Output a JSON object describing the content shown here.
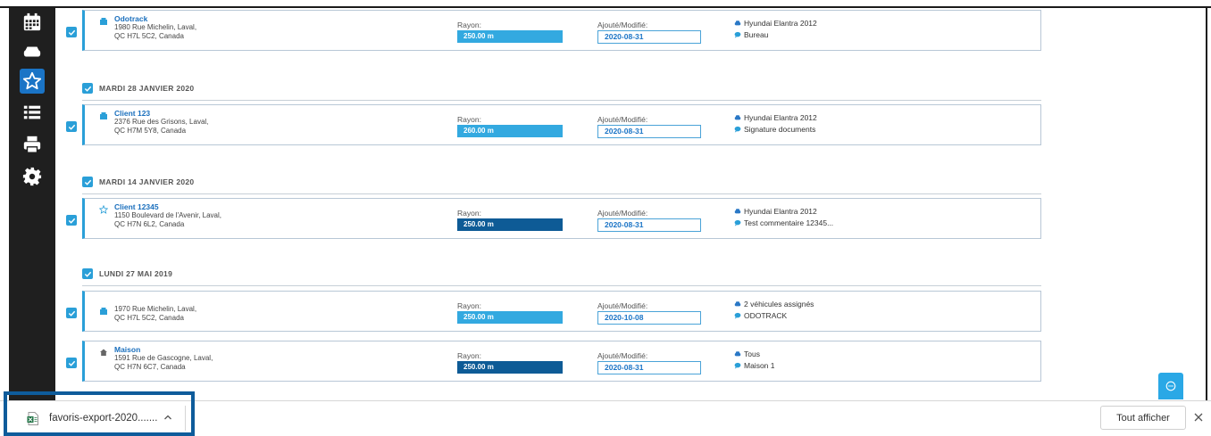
{
  "sidebar": {
    "items": [
      {
        "name": "calendar",
        "icon": "calendar-icon",
        "active": false
      },
      {
        "name": "vehicle",
        "icon": "car-icon",
        "active": false
      },
      {
        "name": "favorites",
        "icon": "star-icon",
        "active": true
      },
      {
        "name": "list",
        "icon": "list-icon",
        "active": false
      },
      {
        "name": "print",
        "icon": "printer-icon",
        "active": false
      },
      {
        "name": "settings",
        "icon": "gear-icon",
        "active": false
      }
    ]
  },
  "labels": {
    "rayon": "Rayon:",
    "modified": "Ajouté/Modifié:"
  },
  "groups": [
    {
      "date": "",
      "cards": [
        {
          "icon": "building-icon",
          "name": "Odotrack",
          "addr1": "1980 Rue Michelin, Laval,",
          "addr2": "QC H7L 5C2, Canada",
          "rayon": "250.00 m",
          "rayon_dark": false,
          "modified": "2020-08-31",
          "vehicle": "Hyundai Elantra 2012",
          "note": "Bureau"
        }
      ]
    },
    {
      "date": "MARDI 28 JANVIER 2020",
      "cards": [
        {
          "icon": "building-icon",
          "name": "Client 123",
          "addr1": "2376 Rue des Grisons, Laval,",
          "addr2": "QC H7M 5Y8, Canada",
          "rayon": "260.00 m",
          "rayon_dark": false,
          "modified": "2020-08-31",
          "vehicle": "Hyundai Elantra 2012",
          "note": "Signature documents"
        }
      ]
    },
    {
      "date": "MARDI 14 JANVIER 2020",
      "cards": [
        {
          "icon": "star-outline-icon",
          "name": "Client 12345",
          "addr1": "1150 Boulevard de l'Avenir, Laval,",
          "addr2": "QC H7N 6L2, Canada",
          "rayon": "250.00 m",
          "rayon_dark": true,
          "modified": "2020-08-31",
          "vehicle": "Hyundai Elantra 2012",
          "note": "Test commentaire 12345..."
        }
      ]
    },
    {
      "date": "LUNDI 27 MAI 2019",
      "cards": [
        {
          "icon": "building-icon",
          "name": "",
          "addr1": "1970 Rue Michelin, Laval,",
          "addr2": "QC H7L 5C2, Canada",
          "rayon": "250.00 m",
          "rayon_dark": false,
          "modified": "2020-10-08",
          "vehicle": "2 véhicules assignés",
          "note": "ODOTRACK"
        },
        {
          "icon": "home-icon",
          "name": "Maison",
          "addr1": "1591 Rue de Gascogne, Laval,",
          "addr2": "QC H7N 6C7, Canada",
          "rayon": "250.00 m",
          "rayon_dark": true,
          "modified": "2020-08-31",
          "vehicle": "Tous",
          "note": "Maison 1"
        }
      ]
    }
  ],
  "download_bar": {
    "file_name": "favoris-export-2020.......",
    "show_all": "Tout afficher"
  },
  "colors": {
    "accent": "#2a9fd8",
    "rayon_light": "#33a9e0",
    "rayon_dark": "#0e5b96",
    "sidebar": "#1f1f1f",
    "highlight": "#0e5c9b"
  }
}
